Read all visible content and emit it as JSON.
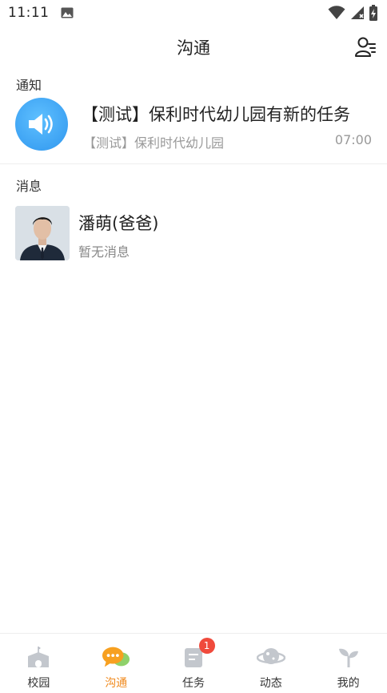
{
  "status_bar": {
    "time": "11:11"
  },
  "header": {
    "title": "沟通"
  },
  "sections": {
    "notice_label": "通知",
    "message_label": "消息"
  },
  "notice": {
    "title": "【测试】保利时代幼儿园有新的任务",
    "subtitle": "【测试】保利时代幼儿园",
    "time": "07:00",
    "avatar_color": "#2f96ee"
  },
  "message": {
    "name": "潘萌(爸爸)",
    "preview": "暂无消息"
  },
  "tabbar": {
    "active_color": "#f08a1e",
    "tabs": [
      {
        "label": "校园",
        "icon": "school-icon"
      },
      {
        "label": "沟通",
        "icon": "chat-icon",
        "active": true
      },
      {
        "label": "任务",
        "icon": "task-icon",
        "badge": "1"
      },
      {
        "label": "动态",
        "icon": "planet-icon"
      },
      {
        "label": "我的",
        "icon": "sprout-icon"
      }
    ]
  }
}
